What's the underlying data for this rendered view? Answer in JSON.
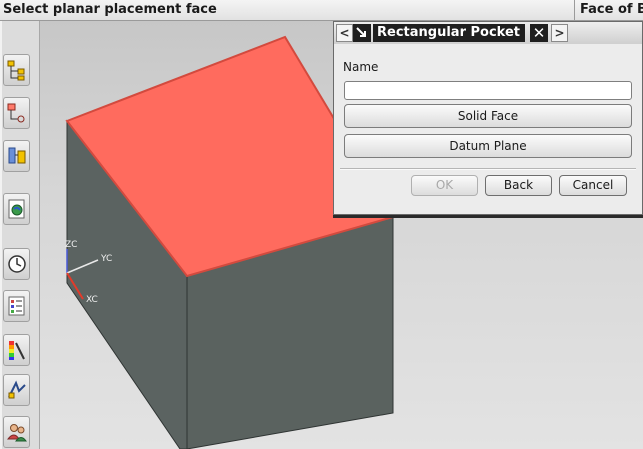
{
  "status_bar": {
    "prompt": "Select planar placement face",
    "selection_info": "Face of Bl"
  },
  "toolbar": {
    "tools": [
      "assembly-navigator-icon",
      "part-navigator-icon",
      "constraint-navigator-icon",
      "web-browser-icon",
      "history-icon",
      "system-materials-icon",
      "visualization-icon",
      "process-studio-icon",
      "roles-icon"
    ]
  },
  "viewport": {
    "triad": {
      "zc": "ZC",
      "yc": "YC",
      "xc": "XC"
    },
    "colors": {
      "selected_face": "#ff6b5e",
      "body_face": "#5a6260",
      "background": "#d6d6d6"
    }
  },
  "dialog": {
    "title": "Rectangular Pocket",
    "name_label": "Name",
    "name_value": "",
    "solid_face_label": "Solid Face",
    "datum_plane_label": "Datum Plane",
    "ok_label": "OK",
    "back_label": "Back",
    "cancel_label": "Cancel",
    "nav_prev": "<",
    "nav_next": ">",
    "close_symbol": "✕"
  }
}
